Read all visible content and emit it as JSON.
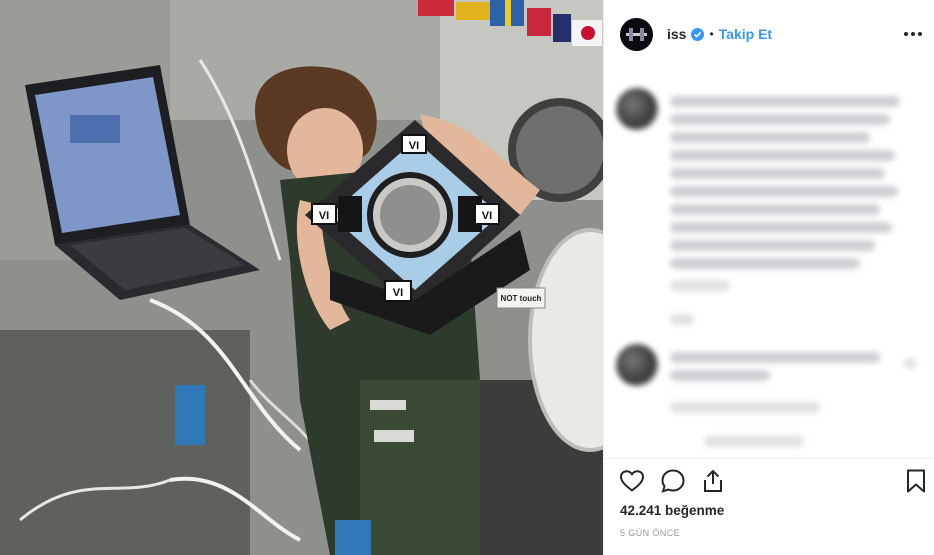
{
  "post": {
    "username": "iss",
    "dot": "•",
    "follow_label": "Takip Et",
    "likes": "42.241 beğenme",
    "timestamp": "5 GÜN ÖNCE"
  },
  "photo_labels": {
    "marker_top": "VI",
    "marker_left": "VI",
    "marker_right": "VI",
    "marker_bottom": "VI",
    "not_touch": "NOT touch"
  },
  "colors": {
    "link_blue": "#3897f0",
    "text": "#262626",
    "muted": "#999999"
  },
  "icons": [
    "verified-badge-icon",
    "more-options-icon",
    "heart-icon",
    "comment-icon",
    "share-icon",
    "bookmark-icon"
  ]
}
